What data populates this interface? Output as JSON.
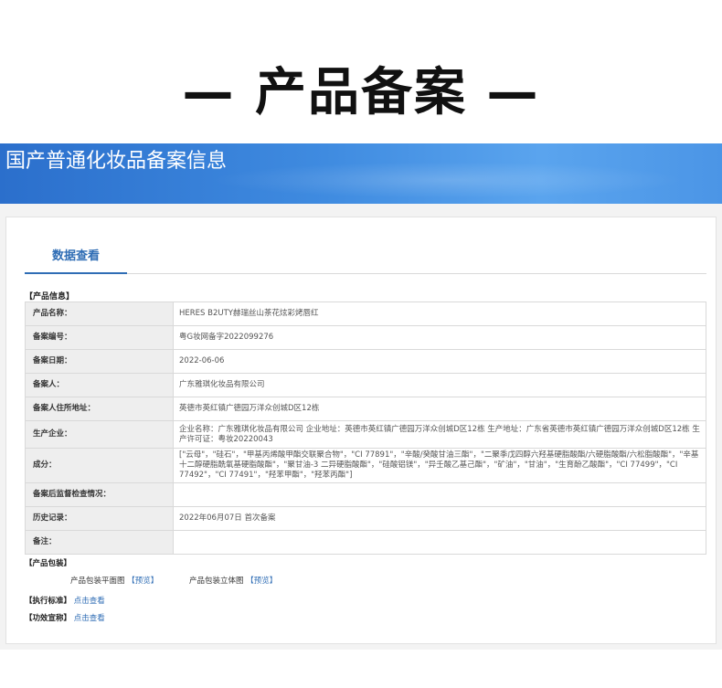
{
  "hero": {
    "title": "— 产品备案 —"
  },
  "banner": {
    "title": "国产普通化妆品备案信息"
  },
  "tabs": [
    {
      "label": "数据查看"
    }
  ],
  "product_info": {
    "section_label": "【产品信息】",
    "rows": [
      {
        "label": "产品名称：",
        "value": "HERES B2UTY赫瑞丝山茶花炫彩烤唇红"
      },
      {
        "label": "备案编号：",
        "value": "粤G妆网备字2022099276"
      },
      {
        "label": "备案日期：",
        "value": "2022-06-06"
      },
      {
        "label": "备案人：",
        "value": "广东雅琪化妆品有限公司"
      },
      {
        "label": "备案人住所地址：",
        "value": "英德市英红镇广德园万洋众创城D区12栋"
      },
      {
        "label": "生产企业：",
        "value": "企业名称：广东雅琪化妆品有限公司 企业地址：英德市英红镇广德园万洋众创城D区12栋 生产地址：广东省英德市英红镇广德园万洋众创城D区12栋 生产许可证：粤妆20220043"
      },
      {
        "label": "成分：",
        "value": "[\"云母\"，\"硅石\"，\"甲基丙烯酸甲酯交联聚合物\"，\"CI 77891\"，\"辛酸/癸酸甘油三酯\"，\"二聚季戊四醇六羟基硬脂酸酯/六硬脂酸酯/六松脂酸酯\"，\"辛基十二醇硬脂酰氧基硬脂酸酯\"，\"聚甘油-3 二异硬脂酸酯\"，\"硅酸铝镁\"，\"异壬酸乙基己酯\"，\"矿油\"，\"甘油\"，\"生育酚乙酸酯\"，\"CI 77499\"，\"CI 77492\"，\"CI 77491\"，\"羟苯甲酯\"，\"羟苯丙酯\"]"
      },
      {
        "label": "备案后监督检查情况：",
        "value": ""
      },
      {
        "label": "历史记录：",
        "value": "2022年06月07日 首次备案"
      },
      {
        "label": "备注：",
        "value": ""
      }
    ]
  },
  "packaging": {
    "section_label": "【产品包装】",
    "flat_label": "产品包装平面图",
    "flat_link": "【预览】",
    "three_d_label": "产品包装立体图",
    "three_d_link": "【预览】"
  },
  "standard": {
    "label": "【执行标准】",
    "link": "点击查看"
  },
  "efficacy": {
    "label": "【功效宣称】",
    "link": "点击查看"
  }
}
